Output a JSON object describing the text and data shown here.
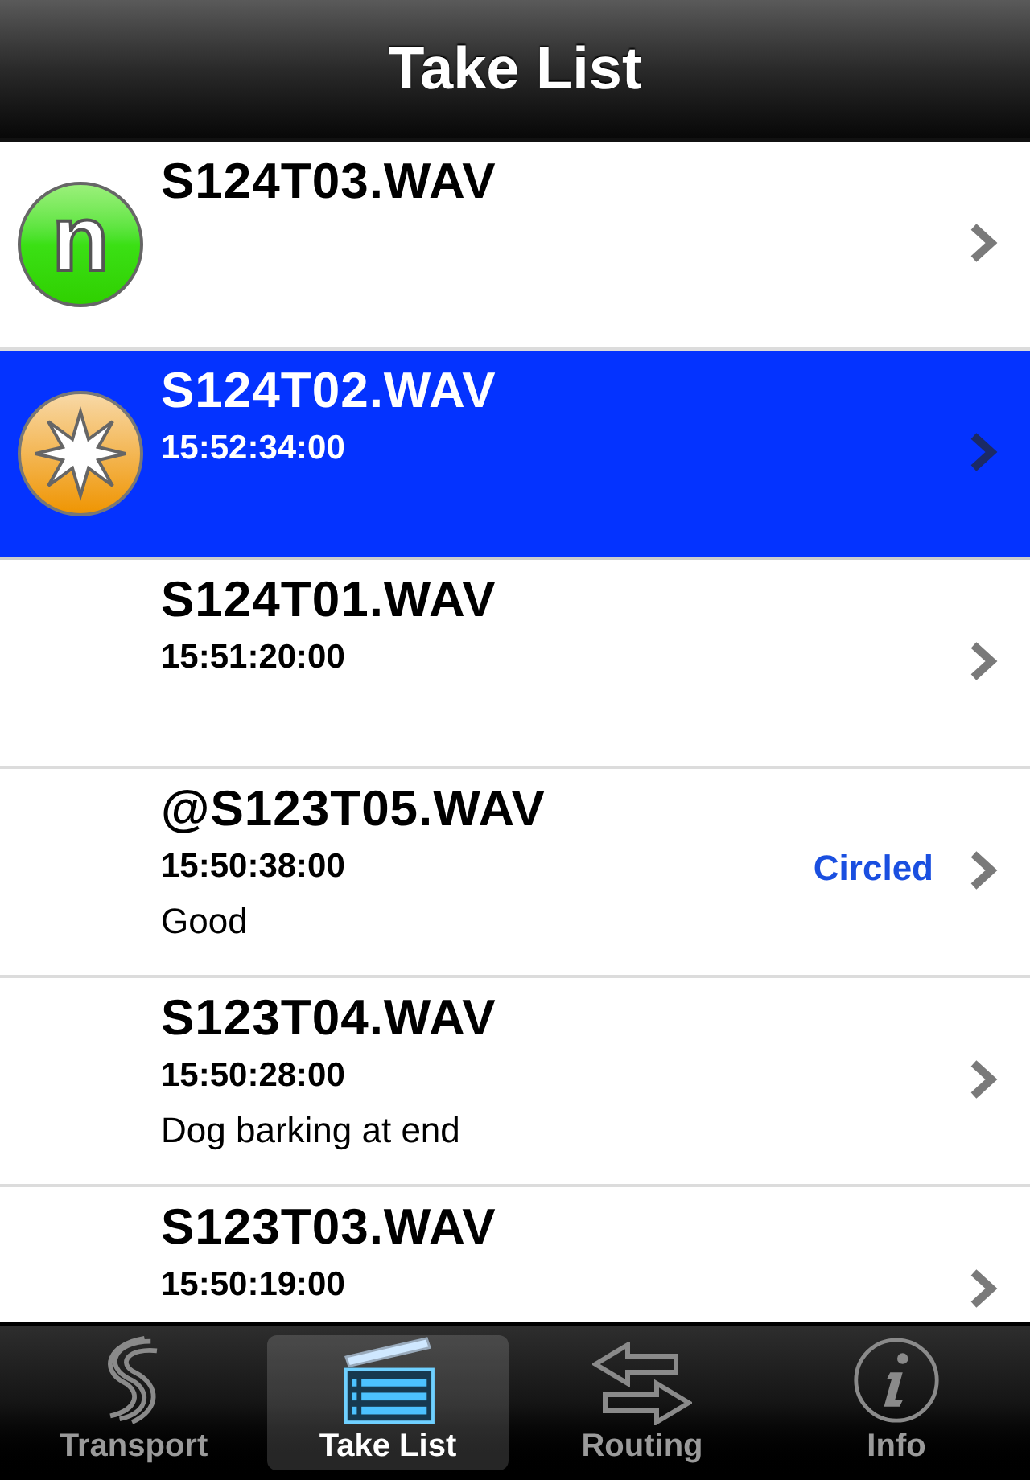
{
  "header": {
    "title": "Take List"
  },
  "takes": [
    {
      "name": "S124T03.WAV",
      "badge": {
        "kind": "new",
        "label": "n"
      },
      "selected": false
    },
    {
      "name": "S124T02.WAV",
      "time": "15:52:34:00",
      "badge": {
        "kind": "star"
      },
      "selected": true
    },
    {
      "name": "S124T01.WAV",
      "time": "15:51:20:00",
      "selected": false
    },
    {
      "name": "@S123T05.WAV",
      "time": "15:50:38:00",
      "note": "Good",
      "tag": "Circled",
      "selected": false
    },
    {
      "name": "S123T04.WAV",
      "time": "15:50:28:00",
      "note": "Dog barking at end",
      "selected": false
    },
    {
      "name": "S123T03.WAV",
      "time": "15:50:19:00",
      "selected": false
    }
  ],
  "tab_bar": [
    {
      "label": "Transport",
      "selected": false
    },
    {
      "label": "Take List",
      "selected": true
    },
    {
      "label": "Routing",
      "selected": false
    },
    {
      "label": "Info",
      "selected": false
    }
  ]
}
